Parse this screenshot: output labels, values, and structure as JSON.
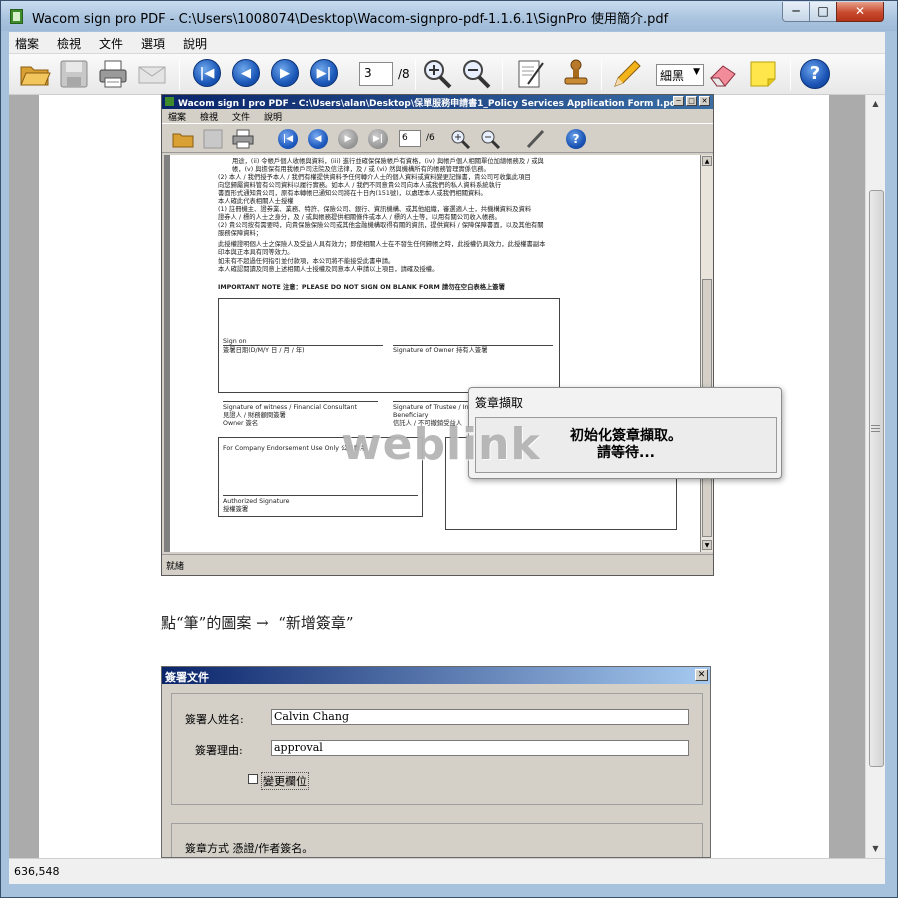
{
  "window": {
    "title": "Wacom sign pro PDF - C:\\Users\\1008074\\Desktop\\Wacom-signpro-pdf-1.1.6.1\\SignPro 使用簡介.pdf",
    "caption_min": "─",
    "caption_max": "□",
    "caption_close": "✕"
  },
  "menu": [
    "檔案",
    "檢視",
    "文件",
    "選項",
    "說明"
  ],
  "toolbar": {
    "page_current": "3",
    "page_total": "/8",
    "pen_color": "細黑",
    "icons": [
      "open-folder-icon",
      "save-icon",
      "print-icon",
      "envelope-icon",
      "first-page-icon",
      "prev-page-icon",
      "next-page-icon",
      "last-page-icon",
      "zoom-in-icon",
      "zoom-out-icon",
      "sign-document-icon",
      "stamp-icon",
      "pencil-icon",
      "eraser-icon",
      "sticky-note-icon",
      "help-icon"
    ]
  },
  "status": {
    "coords": "636,548"
  },
  "document": {
    "shot1": {
      "title": "Wacom sign l pro PDF - C:\\Users\\alan\\Desktop\\保單服務申請書1_Policy Services Application Form I.pdf",
      "menu": [
        "檔案",
        "檢視",
        "文件",
        "說明"
      ],
      "page_current": "6",
      "page_total": "/6",
      "status": "就緒",
      "form_lines": [
        "用途，(ii) 令帳戶個人收帳與資料，(iii) 進行並確保保險帳戶有資格，(iv) 與帳戶個人相關單位加總帳務及 / 或與",
        "帳，(v) 與擔保有用我帳戶司法院及信法律，及 / 或 (vi) 然與機構所有的帳務管理實係信務。",
        "(2)  本人 / 我們授予本人 / 我們有權提供資料予任何轉介人士的個人資料或資料變更記錄書，貴公司可收集此項目",
        "      向您歸屬資料管有公司資料以履行實務。如本人 / 我們不同意貴公司向本人或我們的私人資料系統執行",
        "      書面形式通知貴公司，原有本轉帳已通知公司將在十日內(151號)，以處理本人或我們相關資料。",
        "本人確此代表相關人士授權",
        "(1)  註冊機主、證券業、業務、特許、保險公司、銀行、資訊機構、或其他組織，審選適人士，共機構資料及資料",
        "      證券人 / 標的人士之身分，及 / 或與帳務提供相關條件或本人 / 標的人士等，以用有關公司收入帳務。",
        "(2)  貴公司按有需要時，向貴保險保險公司或其他金融機構取得有關的資訊，提供資料 / 保障保障書面，以及其他有關",
        "      服務保障資料；",
        "此授權證明個人士之保險人及受益人具有效力；即使相關人士在不發生任何歸帳之時，此授權仍具效力，此授權書副本",
        "印本與正本具有同等效力。",
        "如未有不超過任何指引並付款項，本公司將不能接受此書申請。",
        "本人確認閱讀及同意上述相關人士授權及同意本人申請以上項目，請確及授權。"
      ],
      "important_note": "IMPORTANT NOTE 注意：PLEASE DO NOT SIGN ON BLANK FORM 請勿在空白表格上簽署",
      "sign_on": "Sign on",
      "sign_date": "簽署日期(D/M/Y 日 / 月 / 年)",
      "sig_owner": "Signature of Owner 持有人簽署",
      "sig_witness": "Signature of witness / Financial Consultant",
      "witness_cn": "見證人 / 財務顧問簽署",
      "witness_name": "Owner 簽名",
      "sig_trustee": "Signature of Trustee / Irrevocable",
      "beneficiary": "Beneficiary",
      "trustee_cn": "信託人 / 不可撤銷受益人",
      "company_use": "For Company Endorsement Use Only 公司專用",
      "authorized": "Authorized Signature",
      "authorized_cn": "授權簽署"
    },
    "sig_dialog": {
      "title": "簽章擷取",
      "message_line1": "初始化簽章擷取。",
      "message_line2": "請等待..."
    },
    "watermark": "weblink",
    "instruction": "點“筆”的圖案 →  “新增簽章”",
    "shot2": {
      "title": "簽署文件",
      "close": "✕",
      "signer_label": "簽署人姓名:",
      "signer_value": "Calvin Chang",
      "reason_label": "簽署理由:",
      "reason_value": "approval",
      "advanced_label": "變更欄位",
      "method_label": "簽章方式 憑證/作者簽名。"
    }
  }
}
